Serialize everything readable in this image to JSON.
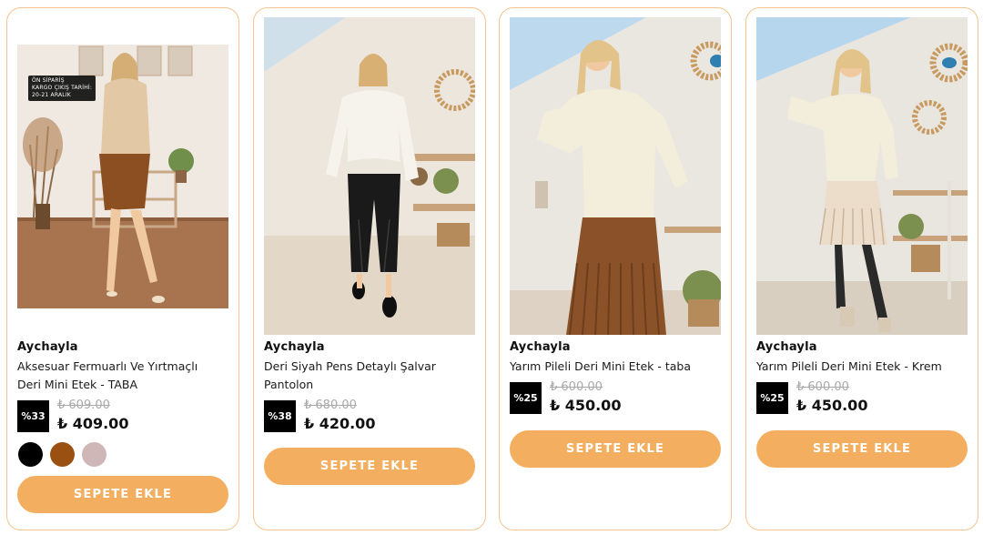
{
  "products": [
    {
      "promo_lines": [
        "ÖN SİPARİŞ",
        "KARGO ÇIKIŞ TARİHİ:",
        "20-21 ARALIK"
      ],
      "brand": "Aychayla",
      "title": "Aksesuar Fermuarlı Ve Yırtmaçlı Deri Mini Etek - TABA",
      "discount": "%33",
      "old_price": "₺ 609.00",
      "new_price": "₺ 409.00",
      "colors": [
        "#000000",
        "#9a5011",
        "#cfb7b8"
      ],
      "button": "SEPETE EKLE"
    },
    {
      "brand": "Aychayla",
      "title": "Deri Siyah Pens Detaylı Şalvar Pantolon",
      "discount": "%38",
      "old_price": "₺ 680.00",
      "new_price": "₺ 420.00",
      "button": "SEPETE EKLE"
    },
    {
      "brand": "Aychayla",
      "title": "Yarım Pileli Deri Mini Etek - taba",
      "discount": "%25",
      "old_price": "₺ 600.00",
      "new_price": "₺ 450.00",
      "button": "SEPETE EKLE"
    },
    {
      "brand": "Aychayla",
      "title": "Yarım Pileli Deri Mini Etek - Krem",
      "discount": "%25",
      "old_price": "₺ 600.00",
      "new_price": "₺ 450.00",
      "button": "SEPETE EKLE"
    }
  ]
}
